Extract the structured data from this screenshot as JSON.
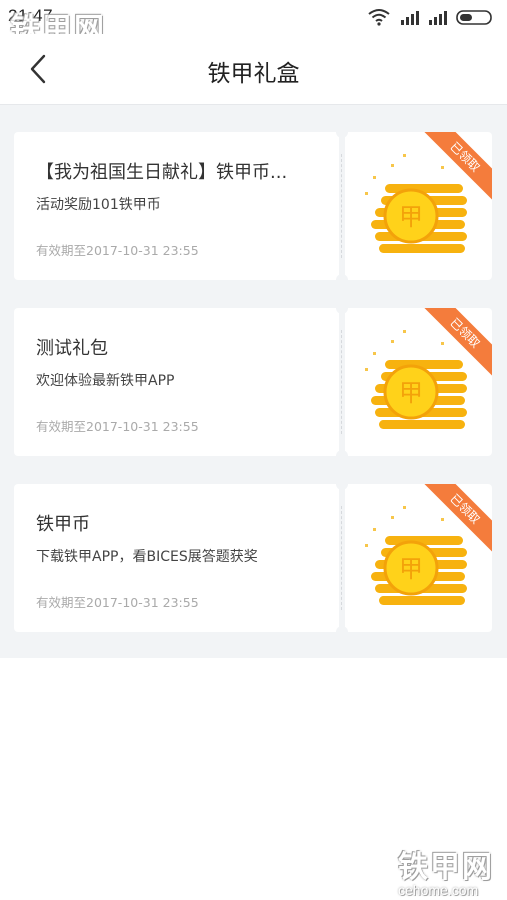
{
  "status_bar": {
    "time": "21:47"
  },
  "header": {
    "title": "铁甲礼盒"
  },
  "cards": [
    {
      "title": "【我为祖国生日献礼】铁甲币...",
      "desc": "活动奖励101铁甲币",
      "expiry": "有效期至2017-10-31 23:55",
      "badge": "已领取"
    },
    {
      "title": "测试礼包",
      "desc": "欢迎体验最新铁甲APP",
      "expiry": "有效期至2017-10-31 23:55",
      "badge": "已领取"
    },
    {
      "title": "铁甲币",
      "desc": "下载铁甲APP，看BICES展答题获奖",
      "expiry": "有效期至2017-10-31 23:55",
      "badge": "已领取"
    }
  ],
  "coin_glyph": "甲",
  "watermark": {
    "brand": "铁甲网",
    "domain": "cehome.com"
  },
  "colors": {
    "ribbon": "#f47c3c",
    "coin": "#f7b20f",
    "list_bg": "#f2f4f6"
  }
}
